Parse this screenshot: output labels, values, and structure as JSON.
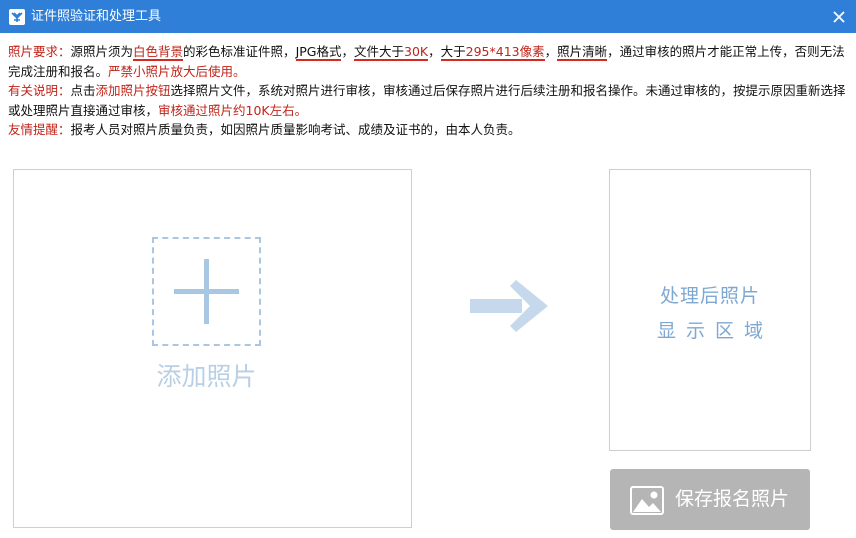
{
  "window": {
    "title": "证件照验证和处理工具"
  },
  "info": {
    "req": {
      "label": "照片要求：",
      "t1": "源照片须为",
      "h1": "白色背景",
      "t2": "的彩色标准证件照，",
      "h2": "JPG格式",
      "t3": "，",
      "h3a": "文件大于",
      "h3b": "30K",
      "t4": "，",
      "h4a": "大于",
      "h4b": "295*413像素",
      "t5": "，",
      "h5": "照片清晰",
      "t6": "，通过审核的照片才能正常上传，否则无法完成注册和报名。",
      "t7": "严禁小照片放大后使用。"
    },
    "note": {
      "label": "有关说明：",
      "t1": "点击",
      "h1": "添加照片按钮",
      "t2": "选择照片文件，系统对照片进行审核，审核通过后保存照片进行后续注册和报名操作。未通过审核的，按提示原因重新选择或处理照片直接通过审核，",
      "h2": "审核通过照片约10K左右。"
    },
    "tip": {
      "label": "友情提醒：",
      "text": "报考人员对照片质量负责，如因照片质量影响考试、成绩及证书的，由本人负责。"
    }
  },
  "add_panel": {
    "label": "添加照片",
    "icon": "plus-icon"
  },
  "result_panel": {
    "line1": "处理后照片",
    "line2": "显示区域"
  },
  "save_button": {
    "label": "保存报名照片",
    "icon": "image-icon"
  },
  "colors": {
    "titlebar": "#2f7fd8",
    "label_red": "#c0241a",
    "placeholder_blue": "#b8cfe6",
    "result_text": "#7ea8d2",
    "save_button_bg": "#b5b5b5"
  }
}
